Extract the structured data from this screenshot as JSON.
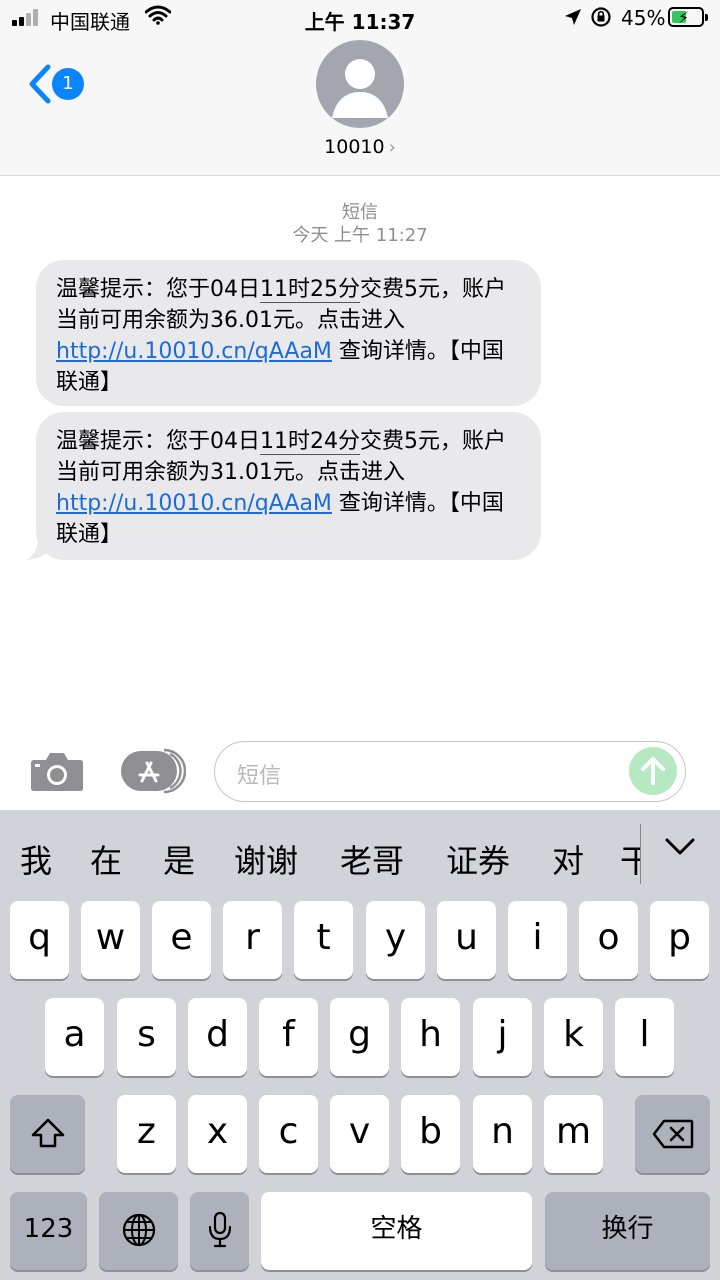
{
  "status_bar": {
    "carrier": "中国联通",
    "time": "上午 11:37",
    "battery_percent": "45%"
  },
  "header": {
    "back_badge": "1",
    "contact_name": "10010",
    "contact_chevron": "›"
  },
  "conversation": {
    "service_label": "短信",
    "timestamp": "今天 上午 11:27",
    "messages": [
      {
        "pre": "温馨提示：您于04日",
        "highlight": "11时25分",
        "post": "交费5元，账户当前可用余额为36.01元。点击进入",
        "link": "http://u.10010.cn/qAAaM",
        "tail": " 查询详情。【中国联通】"
      },
      {
        "pre": "温馨提示：您于04日",
        "highlight": "11时24分",
        "post": "交费5元，账户当前可用余额为31.01元。点击进入",
        "link": "http://u.10010.cn/qAAaM",
        "tail": " 查询详情。【中国联通】"
      }
    ]
  },
  "composer": {
    "placeholder": "短信"
  },
  "keyboard": {
    "candidates": [
      "我",
      "在",
      "是",
      "谢谢",
      "老哥",
      "证券",
      "对",
      "干"
    ],
    "row1": [
      "q",
      "w",
      "e",
      "r",
      "t",
      "y",
      "u",
      "i",
      "o",
      "p"
    ],
    "row2": [
      "a",
      "s",
      "d",
      "f",
      "g",
      "h",
      "j",
      "k",
      "l"
    ],
    "row3": [
      "z",
      "x",
      "c",
      "v",
      "b",
      "n",
      "m"
    ],
    "numbers_key": "123",
    "space_key": "空格",
    "return_key": "换行"
  },
  "icons": {
    "back": "chevron-left-icon",
    "camera": "camera-icon",
    "appstore": "app-store-icon",
    "send": "arrow-up-icon",
    "shift": "shift-icon",
    "delete": "backspace-icon",
    "globe": "globe-icon",
    "mic": "microphone-icon"
  },
  "colors": {
    "accent": "#0a84ff",
    "bubble": "#e9e9eb",
    "link": "#1a6cd8",
    "send": "#b6e9c2",
    "battery": "#34c759"
  }
}
